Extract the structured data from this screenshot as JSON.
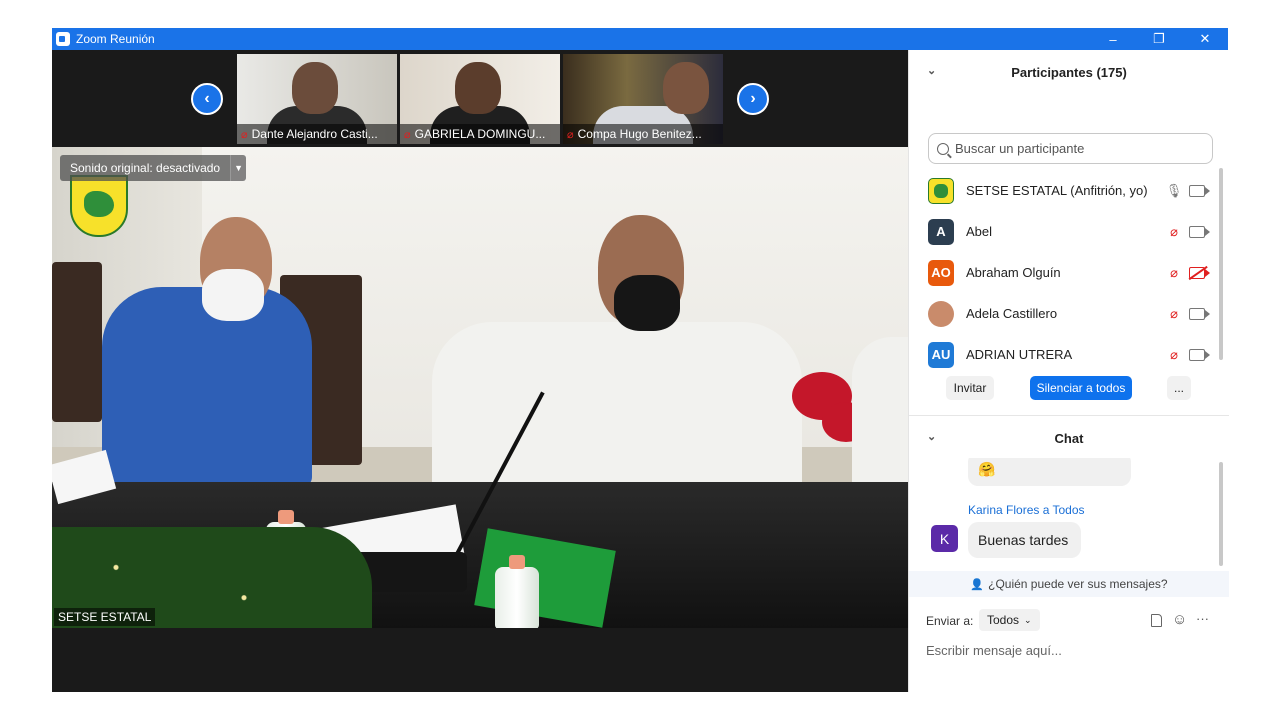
{
  "window": {
    "title": "Zoom Reunión",
    "controls": [
      "minimize-icon",
      "restore-icon",
      "close-icon"
    ]
  },
  "thumbnails": [
    {
      "name": "Dante Alejandro Casti..."
    },
    {
      "name": "GABRIELA DOMINGU..."
    },
    {
      "name": "Compa Hugo Benitez..."
    }
  ],
  "main_video": {
    "sound_label": "Sonido original: desactivado",
    "speaker_name": "SETSE ESTATAL"
  },
  "participants": {
    "header": "Participantes (175)",
    "search_placeholder": "Buscar un participante",
    "list": [
      {
        "initials": "",
        "name": "SETSE ESTATAL (Anfitrión, yo)",
        "color": "#f7e12a",
        "mic": "on",
        "cam": "on"
      },
      {
        "initials": "A",
        "name": "Abel",
        "color": "#2c3e50",
        "mic": "off",
        "cam": "on"
      },
      {
        "initials": "AO",
        "name": "Abraham Olguín",
        "color": "#e8590c",
        "mic": "off",
        "cam": "off"
      },
      {
        "initials": "",
        "name": "Adela Castillero",
        "color": "#c98b6b",
        "mic": "off",
        "cam": "on"
      },
      {
        "initials": "AU",
        "name": "ADRIAN UTRERA",
        "color": "#1f7ad6",
        "mic": "off",
        "cam": "on"
      }
    ],
    "invite_label": "Invitar",
    "mute_all_label": "Silenciar a todos",
    "more_label": "..."
  },
  "chat": {
    "header": "Chat",
    "prev_emoji": "🤗",
    "sender": "Karina Flores a Todos",
    "sender_initial": "K",
    "message": "Buenas tardes",
    "who_sees": "¿Quién puede ver sus mensajes?",
    "send_to_label": "Enviar a:",
    "send_to_value": "Todos",
    "input_placeholder": "Escribir mensaje aquí...",
    "more_label": "···"
  },
  "colors": {
    "accent": "#1a73e8",
    "button_blue": "#0e72ed",
    "muted_red": "#e02020"
  }
}
